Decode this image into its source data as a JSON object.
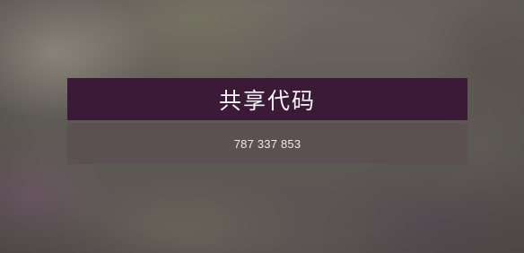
{
  "dialog": {
    "title": "共享代码",
    "code": "787 337 853"
  },
  "colors": {
    "header_bg": "#3b1a38",
    "body_bg": "#5c5052",
    "text": "#f5f2f6"
  }
}
